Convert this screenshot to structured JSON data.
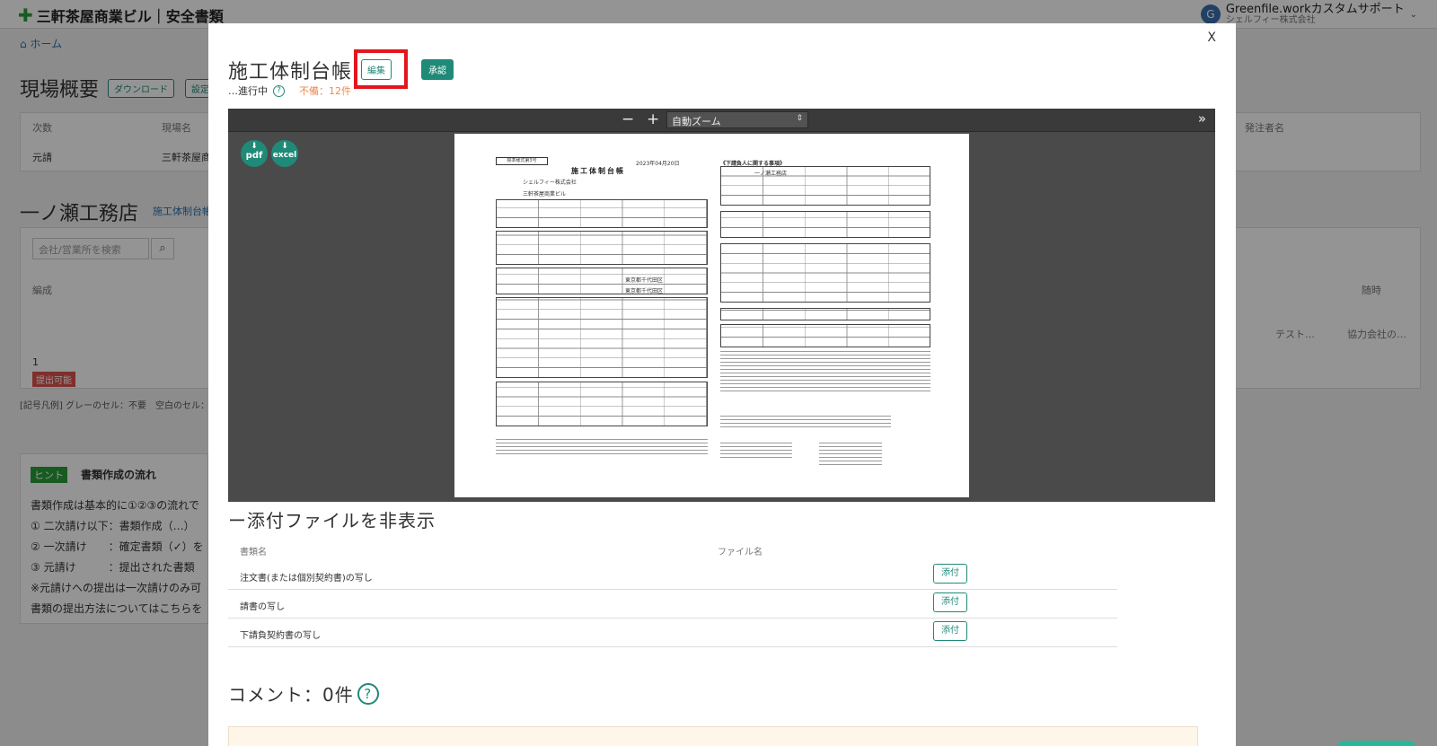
{
  "app": {
    "title": "三軒茶屋商業ビル｜安全書類",
    "user_initial": "G",
    "user_name": "Greenfile.workカスタムサポート",
    "user_company": "シェルフィー株式会社"
  },
  "background": {
    "breadcrumb": "⌂ ホーム",
    "page_title": "現場概要",
    "buttons": [
      "ダウンロード",
      "設定"
    ],
    "table": {
      "headers": [
        "次数",
        "現場名",
        "発注者名"
      ],
      "row": [
        "元請",
        "三軒茶屋商"
      ]
    },
    "company_title": "一ノ瀬工務店",
    "company_link": "施工体制台帳",
    "search_placeholder": "会社/営業所を検索",
    "col_edit": "編成",
    "col_any": "随時",
    "row_no": "1",
    "badge": "提出可能",
    "cell_test": "テスト…",
    "cell_partner": "協力会社の…",
    "legend": "[記号凡例] グレーのセル：不要　空白のセル：未作成",
    "hint": {
      "tag": "ヒント",
      "title": "書類作成の流れ",
      "lines": [
        "書類作成は基本的に①②③の流れで",
        "① 二次請け以下：書類作成（…）",
        "② 一次請け　　：確定書類（✓）を",
        "③ 元請け　　　：提出された書類",
        "※元請けへの提出は一次請けのみ可",
        "書類の提出方法についてはこちらを"
      ]
    }
  },
  "modal": {
    "close": "X",
    "title": "施工体制台帳",
    "edit_label": "編集",
    "approve_label": "承認",
    "status": "…進行中",
    "deficit": "不備：12件",
    "viewer": {
      "zoom_minus": "−",
      "zoom_plus": "+",
      "zoom_value": "自動ズーム",
      "sidebar_toggle": "»",
      "pdf_label": "pdf",
      "excel_label": "excel",
      "page": {
        "form_no": "標準様式第3号",
        "title": "施工体制台帳",
        "date": "2023年04月20日",
        "company": "シェルフィー株式会社",
        "site": "三軒茶屋商業ビル",
        "right_header": "《下請負人に関する事項》",
        "subcontractor": "一ノ瀬工務店",
        "address1": "東京都千代田区",
        "address2": "東京都千代田区"
      }
    },
    "attachments": {
      "heading": "ー添付ファイルを非表示",
      "col_doc": "書類名",
      "col_file": "ファイル名",
      "rows": [
        {
          "name": "注文書(または個別契約書)の写し",
          "button": "添付"
        },
        {
          "name": "請書の写し",
          "button": "添付"
        },
        {
          "name": "下請負契約書の写し",
          "button": "添付"
        }
      ]
    },
    "comments": {
      "heading": "コメント：0件",
      "help": "?"
    }
  },
  "colors": {
    "accent": "#1f8a78",
    "highlight": "#e3161e",
    "warning": "#f08a4b",
    "brand_green": "#2a9d3a"
  }
}
